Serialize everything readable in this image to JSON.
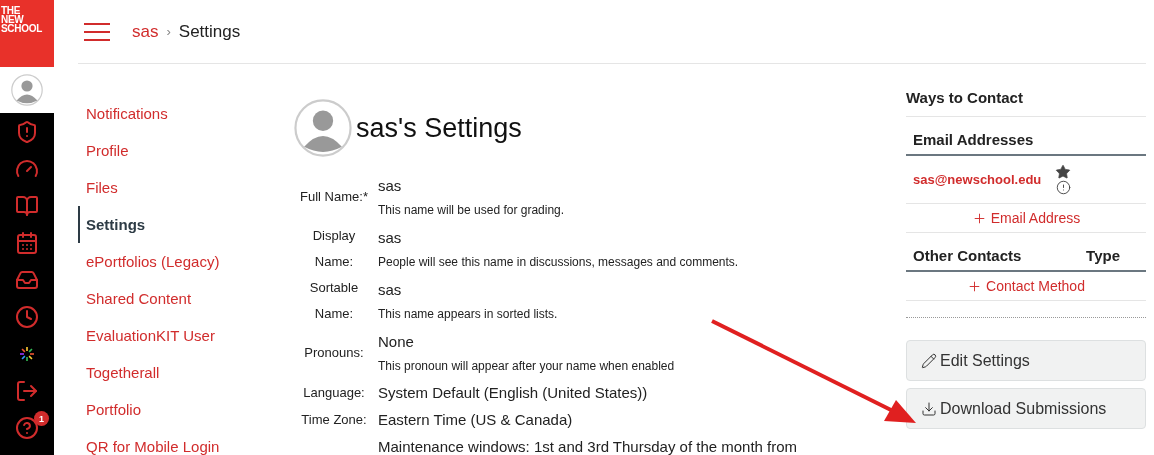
{
  "logo": {
    "lines": [
      "THE",
      "NEW",
      "SCHOOL"
    ]
  },
  "rail": [
    {
      "kind": "admin"
    },
    {
      "kind": "dashboard"
    },
    {
      "kind": "courses"
    },
    {
      "kind": "calendar"
    },
    {
      "kind": "inbox"
    },
    {
      "kind": "history"
    },
    {
      "kind": "burst"
    },
    {
      "kind": "logout"
    },
    {
      "kind": "help",
      "badge": "1"
    }
  ],
  "breadcrumb": {
    "parent": "sas",
    "separator": "›",
    "current": "Settings"
  },
  "nav": [
    {
      "label": "Notifications",
      "selected": false
    },
    {
      "label": "Profile",
      "selected": false
    },
    {
      "label": "Files",
      "selected": false
    },
    {
      "label": "Settings",
      "selected": true
    },
    {
      "label": "ePortfolios (Legacy)",
      "selected": false
    },
    {
      "label": "Shared Content",
      "selected": false
    },
    {
      "label": "EvaluationKIT User",
      "selected": false
    },
    {
      "label": "Togetherall",
      "selected": false
    },
    {
      "label": "Portfolio",
      "selected": false
    },
    {
      "label": "QR for Mobile Login",
      "selected": false
    }
  ],
  "title": "sas's Settings",
  "fields": [
    {
      "label": "Full Name:*",
      "value": "sas",
      "hint": "This name will be used for grading."
    },
    {
      "label": "Display Name:",
      "value": "sas",
      "hint": "People will see this name in discussions, messages and comments."
    },
    {
      "label": "Sortable Name:",
      "value": "sas",
      "hint": "This name appears in sorted lists."
    },
    {
      "label": "Pronouns:",
      "value": "None",
      "hint": "This pronoun will appear after your name when enabled"
    },
    {
      "label": "Language:",
      "value": "System Default (English (United States))"
    },
    {
      "label": "Time Zone:",
      "value": "Eastern Time (US & Canada)"
    },
    {
      "value": "Maintenance windows: 1st and 3rd Thursday of the month from"
    }
  ],
  "contact": {
    "title": "Ways to Contact",
    "email_header": "Email Addresses",
    "emails": [
      "sas@newschool.edu"
    ],
    "add_email": "Email Address",
    "other_header": "Other Contacts",
    "type_header": "Type",
    "add_contact": "Contact Method"
  },
  "buttons": [
    {
      "kind": "edit",
      "label": "Edit Settings"
    },
    {
      "kind": "download",
      "label": "Download Submissions"
    }
  ],
  "annotation": {
    "kind": "arrow"
  }
}
